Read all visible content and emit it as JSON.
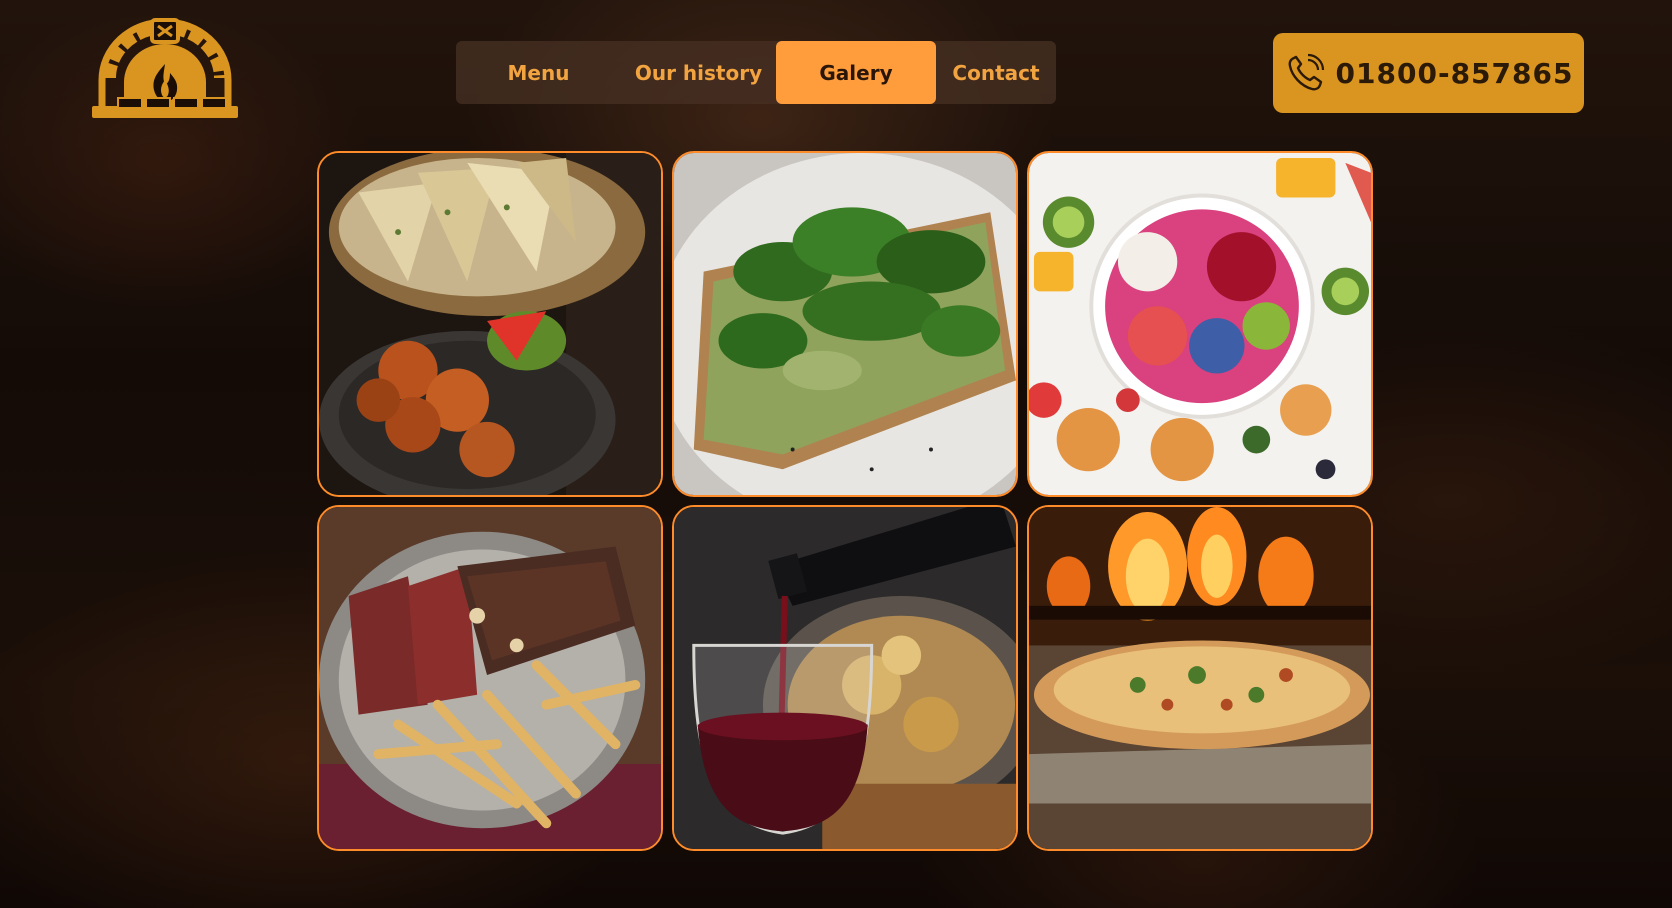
{
  "nav": {
    "items": [
      {
        "label": "Menu"
      },
      {
        "label": "Our history"
      },
      {
        "label": "Galery",
        "active": true
      },
      {
        "label": "Contact"
      }
    ]
  },
  "phone": {
    "number": "01800-857865",
    "icon": "phone-icon"
  },
  "colors": {
    "accent": "#ff9d3d",
    "phone_bg": "#d9951f",
    "tile_border": "#ff8c2a",
    "nav_text": "#f2a440"
  },
  "gallery": {
    "images": [
      {
        "subject": "naan-bread-and-fried-pakora"
      },
      {
        "subject": "spinach-avocado-toast"
      },
      {
        "subject": "fruit-smoothie-bowl"
      },
      {
        "subject": "steak-and-fries"
      },
      {
        "subject": "red-wine-pour"
      },
      {
        "subject": "wood-fired-pizza"
      }
    ]
  }
}
